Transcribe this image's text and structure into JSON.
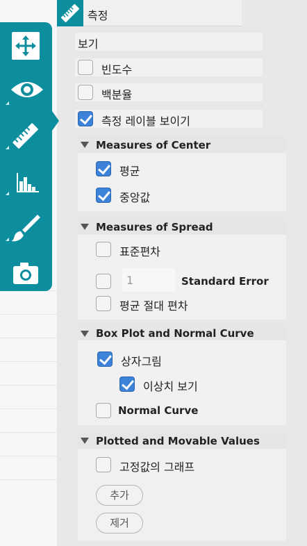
{
  "header": {
    "title": "측정"
  },
  "toolbar": {
    "tools": [
      {
        "name": "move-tool",
        "icon": "move-arrows-icon"
      },
      {
        "name": "view-tool",
        "icon": "eye-icon"
      },
      {
        "name": "measure-tool",
        "icon": "ruler-icon",
        "active": true
      },
      {
        "name": "graph-tool",
        "icon": "histogram-icon"
      },
      {
        "name": "brush-tool",
        "icon": "brush-icon"
      },
      {
        "name": "camera-tool",
        "icon": "camera-icon"
      }
    ],
    "color": "#0c8e9f"
  },
  "view": {
    "label": "보기",
    "frequency": {
      "label": "빈도수",
      "checked": false
    },
    "percent": {
      "label": "백분율",
      "checked": false
    },
    "show_labels": {
      "label": "측정 레이블 보이기",
      "checked": true
    }
  },
  "center": {
    "title": "Measures of Center",
    "mean": {
      "label": "평균",
      "checked": true
    },
    "median": {
      "label": "중앙값",
      "checked": true
    }
  },
  "spread": {
    "title": "Measures of Spread",
    "std_dev": {
      "label": "표준편차",
      "checked": false
    },
    "std_error": {
      "label": "Standard Error",
      "checked": false,
      "value": "1"
    },
    "mad": {
      "label": "평균 절대 편차",
      "checked": false
    }
  },
  "boxplot": {
    "title": "Box Plot and Normal Curve",
    "box": {
      "label": "상자그림",
      "checked": true
    },
    "outliers": {
      "label": "이상치 보기",
      "checked": true
    },
    "normal": {
      "label": "Normal Curve",
      "checked": false
    }
  },
  "plotted": {
    "title": "Plotted and Movable Values",
    "fixed_graph": {
      "label": "고정값의 그래프",
      "checked": false
    },
    "add_label": "추가",
    "remove_label": "제거"
  }
}
